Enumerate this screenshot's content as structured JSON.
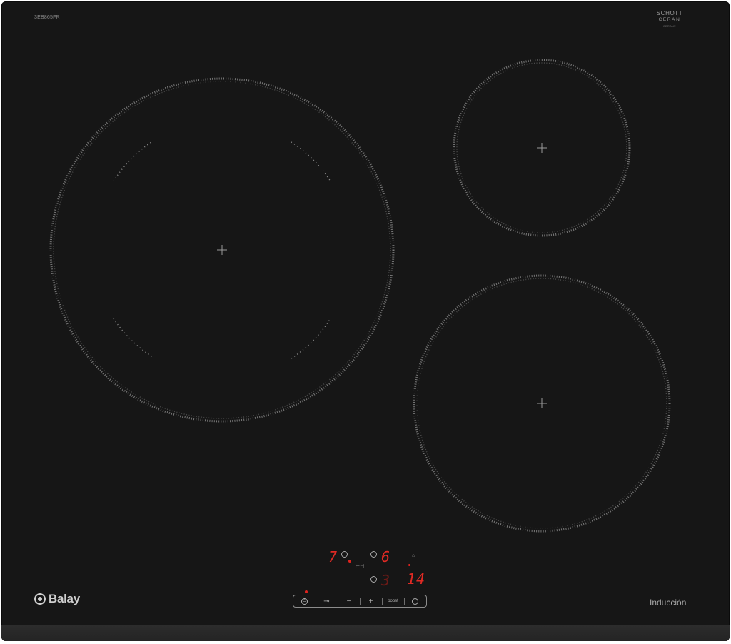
{
  "cooktop": {
    "model_code": "3EB865FR",
    "glass_brand": {
      "line1": "SCHOTT",
      "line2": "CERAN",
      "line3": "CERAN®"
    },
    "brand_name": "Balay",
    "technology_label": "Inducción",
    "colors": {
      "glass": "#161616",
      "display": "#e02a24",
      "ring": "#8a8a8a"
    }
  },
  "display": {
    "left_power_level": "7",
    "right_power_level": "6",
    "bottom_power_level": "3",
    "timer_value": "14"
  },
  "controls": [
    {
      "name": "power-button",
      "icon": "power-icon",
      "label": "⏻"
    },
    {
      "name": "lock-button",
      "icon": "key-lock-icon",
      "label": "⊸"
    },
    {
      "name": "minus-button",
      "icon": "minus-icon",
      "label": "−"
    },
    {
      "name": "plus-button",
      "icon": "plus-icon",
      "label": "+"
    },
    {
      "name": "boost-button",
      "icon": "boost-icon",
      "label": "boost"
    },
    {
      "name": "timer-button",
      "icon": "clock-icon",
      "label": ""
    }
  ]
}
